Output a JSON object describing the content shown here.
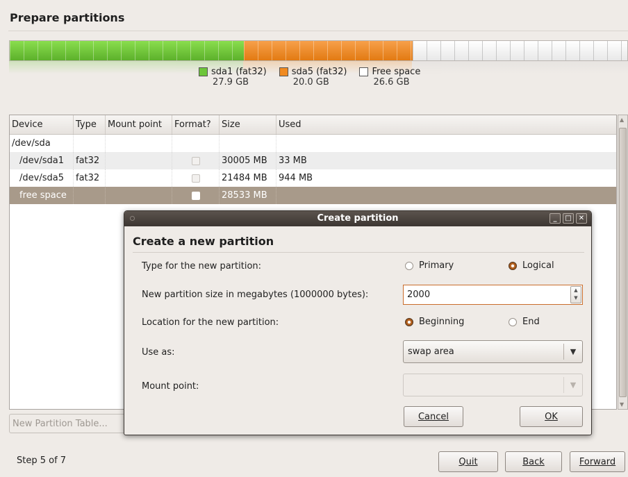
{
  "page": {
    "title": "Prepare partitions"
  },
  "partition_bar": {
    "segments": [
      {
        "name": "sda1 (fat32)",
        "size": "27.9 GB",
        "color": "#6dc53a",
        "mb": 30005
      },
      {
        "name": "sda5 (fat32)",
        "size": "20.0 GB",
        "color": "#f08a20",
        "mb": 21484
      },
      {
        "name": "Free space",
        "size": "26.6 GB",
        "color": "#ffffff",
        "mb": 28533
      }
    ]
  },
  "table": {
    "headers": [
      "Device",
      "Type",
      "Mount point",
      "Format?",
      "Size",
      "Used"
    ],
    "rows": [
      {
        "device": "/dev/sda",
        "type": "",
        "mount": "",
        "format": "",
        "size": "",
        "used": ""
      },
      {
        "device": "/dev/sda1",
        "type": "fat32",
        "mount": "",
        "format": "unchecked",
        "size": "30005 MB",
        "used": "33 MB"
      },
      {
        "device": "/dev/sda5",
        "type": "fat32",
        "mount": "",
        "format": "unchecked",
        "size": "21484 MB",
        "used": "944 MB"
      },
      {
        "device": "free space",
        "type": "",
        "mount": "",
        "format": "unchecked",
        "size": "28533 MB",
        "used": "",
        "selected": true
      }
    ]
  },
  "new_partition_table_button": "New Partition Table...",
  "footer": {
    "step": "Step 5 of 7",
    "quit": "Quit",
    "back": "Back",
    "forward": "Forward"
  },
  "dialog": {
    "window_title": "Create partition",
    "heading": "Create a new partition",
    "type_label": "Type for the new partition:",
    "type_options": [
      "Primary",
      "Logical"
    ],
    "type_selected": "Logical",
    "size_label": "New partition size in megabytes (1000000 bytes):",
    "size_value": "2000",
    "location_label": "Location for the new partition:",
    "location_options": [
      "Beginning",
      "End"
    ],
    "location_selected": "Beginning",
    "use_as_label": "Use as:",
    "use_as_value": "swap area",
    "mount_label": "Mount point:",
    "mount_value": "",
    "cancel": "Cancel",
    "ok": "OK"
  }
}
